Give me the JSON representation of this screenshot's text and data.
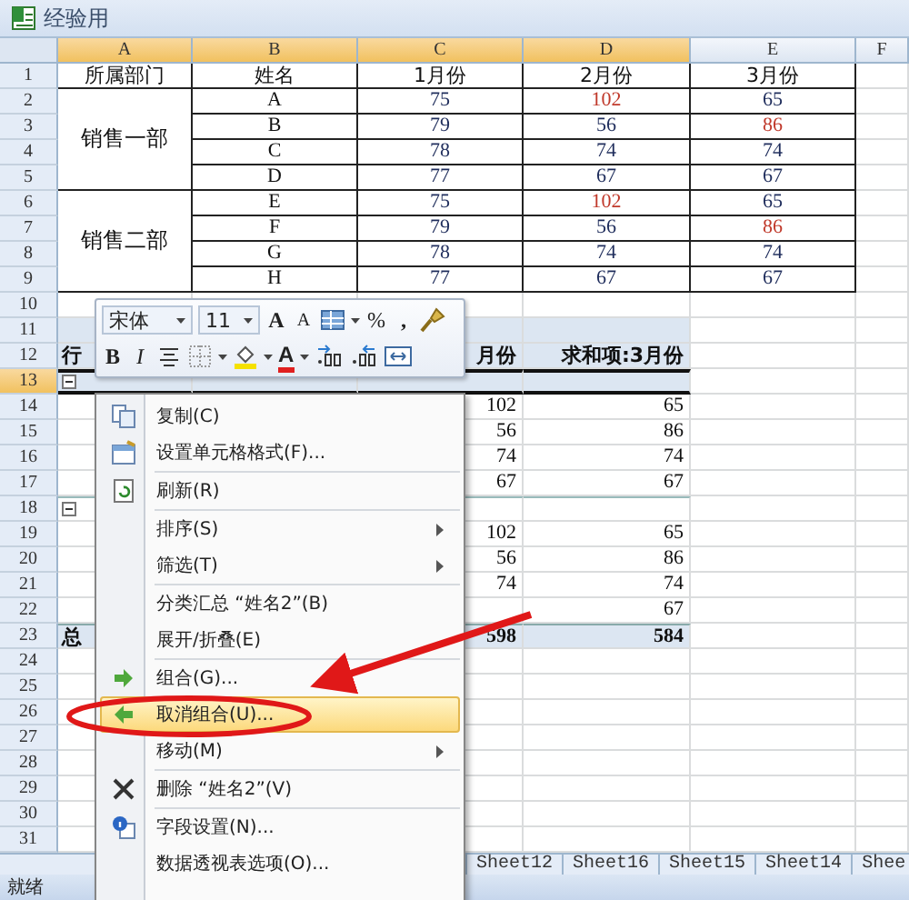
{
  "window": {
    "title": "经验用"
  },
  "columns": [
    {
      "label": "A",
      "selected": true
    },
    {
      "label": "B",
      "selected": true
    },
    {
      "label": "C",
      "selected": true
    },
    {
      "label": "D",
      "selected": true
    },
    {
      "label": "E",
      "selected": false
    },
    {
      "label": "F",
      "selected": false
    }
  ],
  "row_numbers": [
    {
      "label": "1",
      "selected": false
    },
    {
      "label": "2",
      "selected": false
    },
    {
      "label": "3",
      "selected": false
    },
    {
      "label": "4",
      "selected": false
    },
    {
      "label": "5",
      "selected": false
    },
    {
      "label": "6",
      "selected": false
    },
    {
      "label": "7",
      "selected": false
    },
    {
      "label": "8",
      "selected": false
    },
    {
      "label": "9",
      "selected": false
    },
    {
      "label": "10",
      "selected": false
    },
    {
      "label": "11",
      "selected": false
    },
    {
      "label": "12",
      "selected": false
    },
    {
      "label": "13",
      "selected": true
    },
    {
      "label": "14",
      "selected": false
    },
    {
      "label": "15",
      "selected": false
    },
    {
      "label": "16",
      "selected": false
    },
    {
      "label": "17",
      "selected": false
    },
    {
      "label": "18",
      "selected": false
    },
    {
      "label": "19",
      "selected": false
    },
    {
      "label": "20",
      "selected": false
    },
    {
      "label": "21",
      "selected": false
    },
    {
      "label": "22",
      "selected": false
    },
    {
      "label": "23",
      "selected": false
    },
    {
      "label": "24",
      "selected": false
    },
    {
      "label": "25",
      "selected": false
    },
    {
      "label": "26",
      "selected": false
    },
    {
      "label": "27",
      "selected": false
    },
    {
      "label": "28",
      "selected": false
    },
    {
      "label": "29",
      "selected": false
    },
    {
      "label": "30",
      "selected": false
    },
    {
      "label": "31",
      "selected": false
    }
  ],
  "table": {
    "headers": [
      "所属部门",
      "姓名",
      "1月份",
      "2月份",
      "3月份"
    ],
    "groups": [
      {
        "department": "销售一部",
        "rows": [
          {
            "name": "A",
            "values": [
              {
                "text": "75",
                "flagged": false
              },
              {
                "text": "102",
                "flagged": true
              },
              {
                "text": "65",
                "flagged": false
              }
            ]
          },
          {
            "name": "B",
            "values": [
              {
                "text": "79",
                "flagged": false
              },
              {
                "text": "56",
                "flagged": false
              },
              {
                "text": "86",
                "flagged": true
              }
            ]
          },
          {
            "name": "C",
            "values": [
              {
                "text": "78",
                "flagged": false
              },
              {
                "text": "74",
                "flagged": false
              },
              {
                "text": "74",
                "flagged": false
              }
            ]
          },
          {
            "name": "D",
            "values": [
              {
                "text": "77",
                "flagged": false
              },
              {
                "text": "67",
                "flagged": false
              },
              {
                "text": "67",
                "flagged": false
              }
            ]
          }
        ]
      },
      {
        "department": "销售二部",
        "rows": [
          {
            "name": "E",
            "values": [
              {
                "text": "75",
                "flagged": false
              },
              {
                "text": "102",
                "flagged": true
              },
              {
                "text": "65",
                "flagged": false
              }
            ]
          },
          {
            "name": "F",
            "values": [
              {
                "text": "79",
                "flagged": false
              },
              {
                "text": "56",
                "flagged": false
              },
              {
                "text": "86",
                "flagged": true
              }
            ]
          },
          {
            "name": "G",
            "values": [
              {
                "text": "78",
                "flagged": false
              },
              {
                "text": "74",
                "flagged": false
              },
              {
                "text": "74",
                "flagged": false
              }
            ]
          },
          {
            "name": "H",
            "values": [
              {
                "text": "77",
                "flagged": false
              },
              {
                "text": "67",
                "flagged": false
              },
              {
                "text": "67",
                "flagged": false
              }
            ]
          }
        ]
      }
    ]
  },
  "pivot": {
    "row_label": "行",
    "headers": [
      "月份",
      "求和项:3月份"
    ],
    "groups": [
      {
        "expanded": true,
        "rows": [
          [
            "102",
            "65"
          ],
          [
            "56",
            "86"
          ],
          [
            "74",
            "74"
          ],
          [
            "67",
            "67"
          ]
        ]
      },
      {
        "expanded": true,
        "rows": [
          [
            "102",
            "65"
          ],
          [
            "56",
            "86"
          ],
          [
            "74",
            "74"
          ],
          [
            null,
            "67"
          ]
        ]
      }
    ],
    "total": {
      "label": "总",
      "values": [
        "598",
        "584"
      ]
    }
  },
  "mini_toolbar": {
    "font": "宋体",
    "size": "11",
    "grow_font": "A",
    "shrink_font": "A",
    "percent": "%",
    "comma": ",",
    "bold": "B",
    "italic": "I",
    "font_color": "A"
  },
  "context_menu": [
    {
      "kind": "item",
      "label": "复制(C)",
      "submenu": false,
      "selected": false
    },
    {
      "kind": "item",
      "label": "设置单元格格式(F)...",
      "submenu": false,
      "selected": false
    },
    {
      "kind": "separator"
    },
    {
      "kind": "item",
      "label": "刷新(R)",
      "submenu": false,
      "selected": false
    },
    {
      "kind": "separator"
    },
    {
      "kind": "item",
      "label": "排序(S)",
      "submenu": true,
      "selected": false
    },
    {
      "kind": "item",
      "label": "筛选(T)",
      "submenu": true,
      "selected": false
    },
    {
      "kind": "separator"
    },
    {
      "kind": "item",
      "label": "分类汇总 “姓名2”(B)",
      "submenu": false,
      "selected": false
    },
    {
      "kind": "item",
      "label": "展开/折叠(E)",
      "submenu": false,
      "selected": false
    },
    {
      "kind": "separator"
    },
    {
      "kind": "item",
      "label": "组合(G)...",
      "submenu": false,
      "selected": false
    },
    {
      "kind": "item",
      "label": "取消组合(U)...",
      "submenu": false,
      "selected": true
    },
    {
      "kind": "item",
      "label": "移动(M)",
      "submenu": true,
      "selected": false
    },
    {
      "kind": "separator"
    },
    {
      "kind": "item",
      "label": "删除 “姓名2”(V)",
      "submenu": false,
      "selected": false
    },
    {
      "kind": "separator"
    },
    {
      "kind": "item",
      "label": "字段设置(N)...",
      "submenu": false,
      "selected": false
    },
    {
      "kind": "item",
      "label": "数据透视表选项(O)...",
      "submenu": false,
      "selected": false
    }
  ],
  "sheet_tabs": [
    {
      "label": "Sheet12",
      "selected": false
    },
    {
      "label": "Sheet16",
      "selected": false
    },
    {
      "label": "Sheet15",
      "selected": false
    },
    {
      "label": "Sheet14",
      "selected": false
    },
    {
      "label": "Shee",
      "selected": false
    }
  ],
  "status_bar": {
    "text": "就绪"
  }
}
